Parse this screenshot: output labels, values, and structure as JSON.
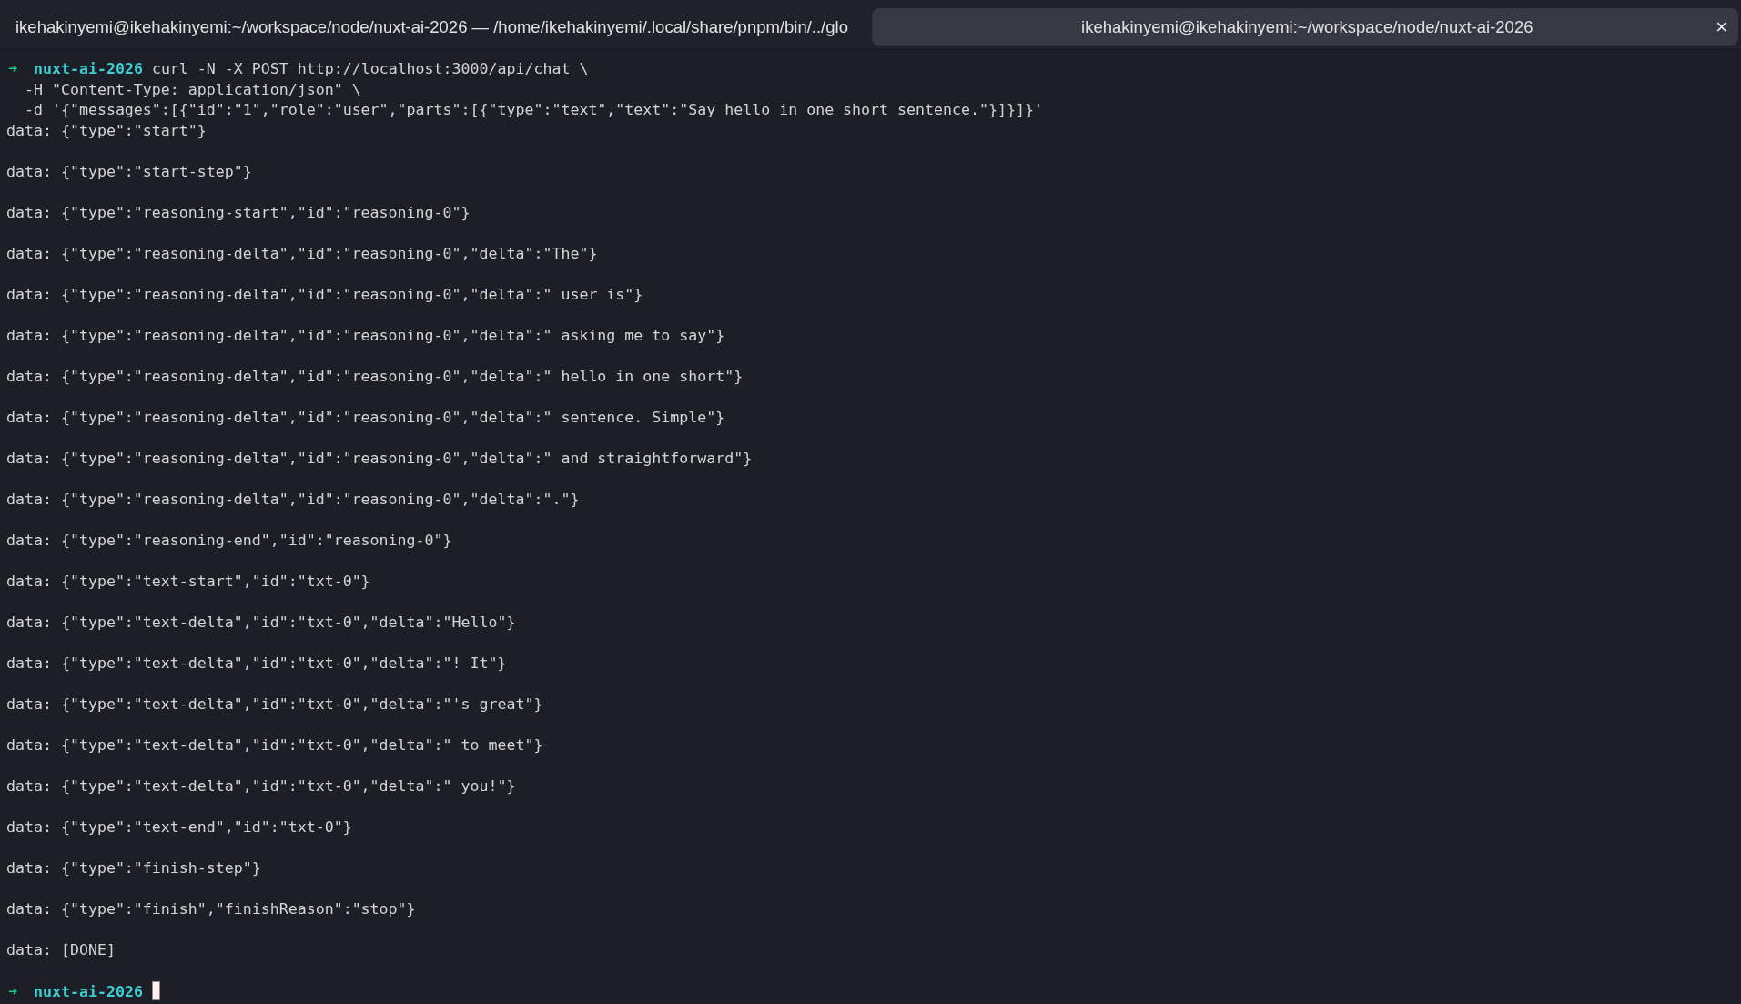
{
  "tabs": [
    {
      "title": "ikehakinyemi@ikehakinyemi:~/workspace/node/nuxt-ai-2026 — /home/ikehakinyemi/.local/share/pnpm/bin/../glo",
      "selected": false
    },
    {
      "title": "ikehakinyemi@ikehakinyemi:~/workspace/node/nuxt-ai-2026",
      "selected": true,
      "close": "×"
    }
  ],
  "terminal": {
    "lines": [
      {
        "kind": "prompt",
        "arrow": "➜",
        "dir": "nuxt-ai-2026",
        "text": "curl -N -X POST http://localhost:3000/api/chat \\"
      },
      {
        "kind": "continuation",
        "text": "  -H \"Content-Type: application/json\" \\"
      },
      {
        "kind": "continuation",
        "text": "  -d '{\"messages\":[{\"id\":\"1\",\"role\":\"user\",\"parts\":[{\"type\":\"text\",\"text\":\"Say hello in one short sentence.\"}]}]}'"
      },
      {
        "kind": "data",
        "text": "data: {\"type\":\"start\"}"
      },
      {
        "kind": "data",
        "text": "data: {\"type\":\"start-step\"}"
      },
      {
        "kind": "data",
        "text": "data: {\"type\":\"reasoning-start\",\"id\":\"reasoning-0\"}"
      },
      {
        "kind": "data",
        "text": "data: {\"type\":\"reasoning-delta\",\"id\":\"reasoning-0\",\"delta\":\"The\"}"
      },
      {
        "kind": "data",
        "text": "data: {\"type\":\"reasoning-delta\",\"id\":\"reasoning-0\",\"delta\":\" user is\"}"
      },
      {
        "kind": "data",
        "text": "data: {\"type\":\"reasoning-delta\",\"id\":\"reasoning-0\",\"delta\":\" asking me to say\"}"
      },
      {
        "kind": "data",
        "text": "data: {\"type\":\"reasoning-delta\",\"id\":\"reasoning-0\",\"delta\":\" hello in one short\"}"
      },
      {
        "kind": "data",
        "text": "data: {\"type\":\"reasoning-delta\",\"id\":\"reasoning-0\",\"delta\":\" sentence. Simple\"}"
      },
      {
        "kind": "data",
        "text": "data: {\"type\":\"reasoning-delta\",\"id\":\"reasoning-0\",\"delta\":\" and straightforward\"}"
      },
      {
        "kind": "data",
        "text": "data: {\"type\":\"reasoning-delta\",\"id\":\"reasoning-0\",\"delta\":\".\"}"
      },
      {
        "kind": "data",
        "text": "data: {\"type\":\"reasoning-end\",\"id\":\"reasoning-0\"}"
      },
      {
        "kind": "data",
        "text": "data: {\"type\":\"text-start\",\"id\":\"txt-0\"}"
      },
      {
        "kind": "data",
        "text": "data: {\"type\":\"text-delta\",\"id\":\"txt-0\",\"delta\":\"Hello\"}"
      },
      {
        "kind": "data",
        "text": "data: {\"type\":\"text-delta\",\"id\":\"txt-0\",\"delta\":\"! It\"}"
      },
      {
        "kind": "data",
        "text": "data: {\"type\":\"text-delta\",\"id\":\"txt-0\",\"delta\":\"'s great\"}"
      },
      {
        "kind": "data",
        "text": "data: {\"type\":\"text-delta\",\"id\":\"txt-0\",\"delta\":\" to meet\"}"
      },
      {
        "kind": "data",
        "text": "data: {\"type\":\"text-delta\",\"id\":\"txt-0\",\"delta\":\" you!\"}"
      },
      {
        "kind": "data",
        "text": "data: {\"type\":\"text-end\",\"id\":\"txt-0\"}"
      },
      {
        "kind": "data",
        "text": "data: {\"type\":\"finish-step\"}"
      },
      {
        "kind": "data",
        "text": "data: {\"type\":\"finish\",\"finishReason\":\"stop\"}"
      },
      {
        "kind": "data",
        "text": "data: [DONE]"
      },
      {
        "kind": "prompt",
        "arrow": "➜",
        "dir": "nuxt-ai-2026",
        "cursor": true
      }
    ]
  }
}
